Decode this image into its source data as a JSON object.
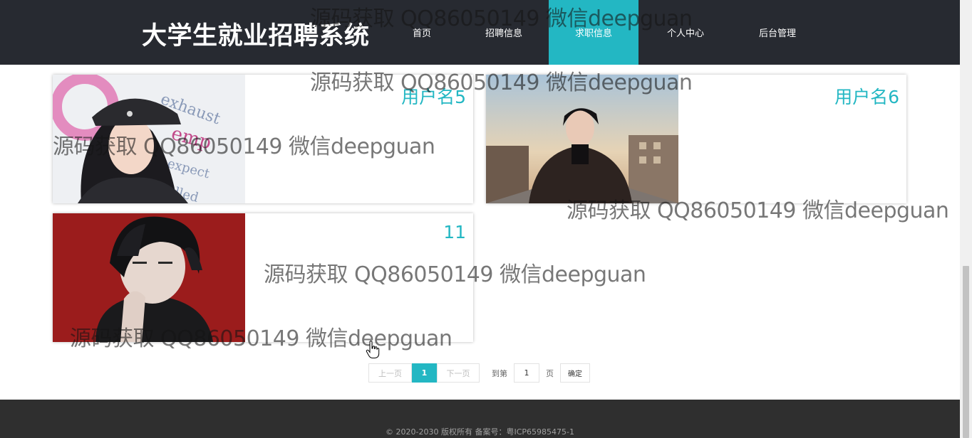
{
  "header": {
    "title": "大学生就业招聘系统",
    "nav": [
      {
        "label": "首页",
        "active": false
      },
      {
        "label": "招聘信息",
        "active": false
      },
      {
        "label": "求职信息",
        "active": true
      },
      {
        "label": "个人中心",
        "active": false
      },
      {
        "label": "后台管理",
        "active": false
      }
    ]
  },
  "cards": [
    {
      "name": "用户名5"
    },
    {
      "name": "用户名6"
    },
    {
      "name": "11"
    }
  ],
  "pagination": {
    "prev_label": "上一页",
    "current_page": "1",
    "next_label": "下一页",
    "goto_label": "到第",
    "page_input_value": "1",
    "page_suffix": "页",
    "confirm_label": "确定"
  },
  "footer": {
    "copyright": "© 2020-2030 版权所有 备案号：粤ICP65985475-1"
  },
  "watermark": "源码获取 QQ86050149 微信deepguan",
  "colors": {
    "accent": "#23b7c3",
    "header_bg": "#272a31",
    "footer_bg": "#2f2f2f"
  }
}
